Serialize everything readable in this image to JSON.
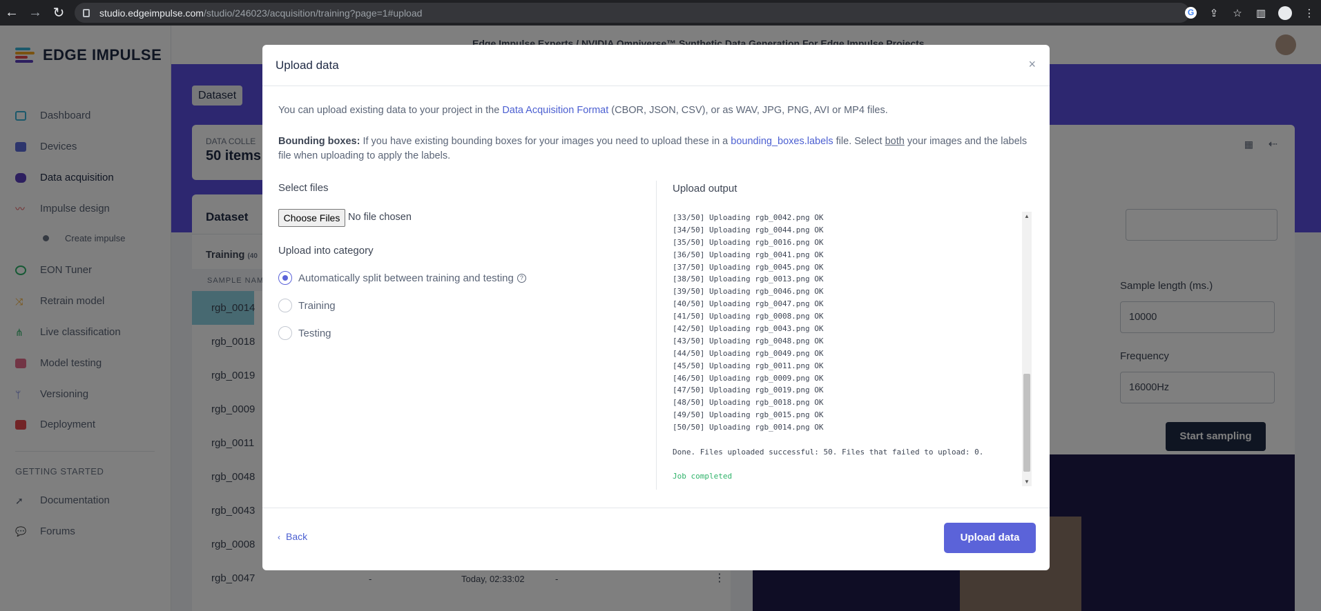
{
  "browser": {
    "url_host": "studio.edgeimpulse.com",
    "url_path": "/studio/246023/acquisition/training?page=1#upload"
  },
  "app": {
    "logo_text": "EDGE IMPULSE",
    "project_breadcrumb": "Edge Impulse Experts  /  NVIDIA Omniverse™ Synthetic Data Generation For Edge Impulse Projects"
  },
  "sidebar": {
    "items": [
      {
        "label": "Dashboard",
        "color": "#38b2d6"
      },
      {
        "label": "Devices",
        "color": "#5a6ad8"
      },
      {
        "label": "Data acquisition",
        "color": "#5b3fbf"
      },
      {
        "label": "Impulse design",
        "color": "#e5484d"
      },
      {
        "label": "Create impulse",
        "color": "#6b7485"
      },
      {
        "label": "EON Tuner",
        "color": "#2fb36a"
      },
      {
        "label": "Retrain model",
        "color": "#f5a623"
      },
      {
        "label": "Live classification",
        "color": "#2fb36a"
      },
      {
        "label": "Model testing",
        "color": "#e56b8a"
      },
      {
        "label": "Versioning",
        "color": "#5a6ad8"
      },
      {
        "label": "Deployment",
        "color": "#e5484d"
      }
    ],
    "section_title": "GETTING STARTED",
    "getting_started": [
      {
        "label": "Documentation"
      },
      {
        "label": "Forums"
      }
    ]
  },
  "background": {
    "tab_dataset": "Dataset",
    "tab_d": "D",
    "data_collected": "DATA COLLE",
    "items": "50 items",
    "dataset_title": "Dataset",
    "training_tab": "Training",
    "training_count": "(40",
    "sample_name_header": "SAMPLE NAM",
    "rows": [
      "rgb_0014",
      "rgb_0018",
      "rgb_0019",
      "rgb_0009",
      "rgb_0011",
      "rgb_0048",
      "rgb_0043",
      "rgb_0008",
      "rgb_0047"
    ],
    "last_row_label": "-",
    "last_row_time": "Today, 02:33:02",
    "last_row_label2": "-",
    "sample_length_label": "Sample length (ms.)",
    "sample_length_value": "10000",
    "frequency_label": "Frequency",
    "frequency_value": "16000Hz",
    "start_sampling": "Start sampling"
  },
  "modal": {
    "title": "Upload data",
    "intro_text_1": "You can upload existing data to your project in the ",
    "intro_link": "Data Acquisition Format",
    "intro_text_2": " (CBOR, JSON, CSV), or as WAV, JPG, PNG, AVI or MP4 files.",
    "bbox_bold": "Bounding boxes:",
    "bbox_text_1": " If you have existing bounding boxes for your images you need to upload these in a ",
    "bbox_link": "bounding_boxes.labels",
    "bbox_text_2": " file. Select ",
    "bbox_both": "both",
    "bbox_text_3": " your images and the labels file when uploading to apply the labels.",
    "select_files_label": "Select files",
    "choose_files_button": "Choose Files",
    "no_file_text": "No file chosen",
    "category_label": "Upload into category",
    "categories": [
      {
        "label": "Automatically split between training and testing",
        "selected": true
      },
      {
        "label": "Training",
        "selected": false
      },
      {
        "label": "Testing",
        "selected": false
      }
    ],
    "output_label": "Upload output",
    "output_lines": [
      "[33/50] Uploading rgb_0042.png OK",
      "[34/50] Uploading rgb_0044.png OK",
      "[35/50] Uploading rgb_0016.png OK",
      "[36/50] Uploading rgb_0041.png OK",
      "[37/50] Uploading rgb_0045.png OK",
      "[38/50] Uploading rgb_0013.png OK",
      "[39/50] Uploading rgb_0046.png OK",
      "[40/50] Uploading rgb_0047.png OK",
      "[41/50] Uploading rgb_0008.png OK",
      "[42/50] Uploading rgb_0043.png OK",
      "[43/50] Uploading rgb_0048.png OK",
      "[44/50] Uploading rgb_0049.png OK",
      "[45/50] Uploading rgb_0011.png OK",
      "[46/50] Uploading rgb_0009.png OK",
      "[47/50] Uploading rgb_0019.png OK",
      "[48/50] Uploading rgb_0018.png OK",
      "[49/50] Uploading rgb_0015.png OK",
      "[50/50] Uploading rgb_0014.png OK"
    ],
    "done_text": "Done. Files uploaded successful: 50. Files that failed to upload: 0.",
    "job_text": "Job completed",
    "back_label": "Back",
    "upload_button": "Upload data"
  },
  "colors": {
    "accent": "#5b63d9",
    "hero": "#5b4fe0",
    "success": "#2fb36a"
  }
}
